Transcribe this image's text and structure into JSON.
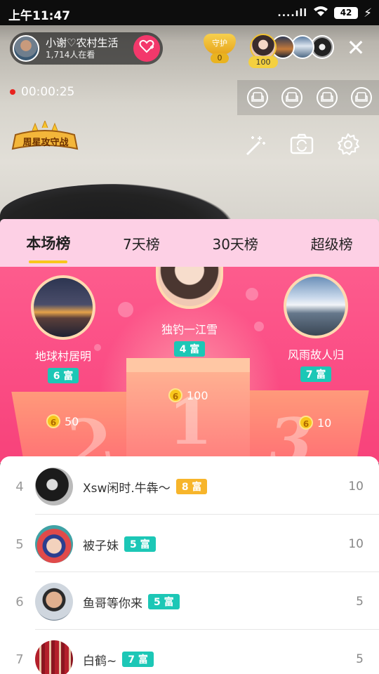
{
  "status_bar": {
    "time": "上午11:47",
    "battery": "42"
  },
  "host": {
    "name": "小谢♡农村生活",
    "viewers": "1,714人在看"
  },
  "guard": {
    "label": "守护",
    "count": "0"
  },
  "top_viewer_badge": "100",
  "timer": "00:00:25",
  "star_badge": "周星攻守战",
  "tabs": [
    {
      "label": "本场榜",
      "active": true
    },
    {
      "label": "7天榜"
    },
    {
      "label": "30天榜"
    },
    {
      "label": "超级榜"
    }
  ],
  "podium": {
    "first": {
      "name": "独钓一江雪",
      "rich": "4 富",
      "score": "100"
    },
    "second": {
      "name": "地球村居明",
      "rich": "6 富",
      "score": "50"
    },
    "third": {
      "name": "风雨故人归",
      "rich": "7 富",
      "score": "10"
    },
    "numbers": [
      "1",
      "2",
      "3"
    ]
  },
  "list": [
    {
      "rank": "4",
      "name": "Xsw闲时.牛犇～",
      "rich": "8 富",
      "rich_color": "#f7b52b",
      "score": "10"
    },
    {
      "rank": "5",
      "name": "被子妹",
      "rich": "5 富",
      "rich_color": "#1cc7b6",
      "score": "10"
    },
    {
      "rank": "6",
      "name": "鱼哥等你来",
      "rich": "5 富",
      "rich_color": "#1cc7b6",
      "score": "5"
    },
    {
      "rank": "7",
      "name": "白鹤~",
      "rich": "7 富",
      "rich_color": "#1cc7b6",
      "score": "5"
    }
  ],
  "colors": {
    "accent_pink": "#f3386b",
    "rich_teal": "#1cc7b6",
    "rich_gold": "#f7b52b",
    "tab_bg": "#fdd0e5"
  }
}
